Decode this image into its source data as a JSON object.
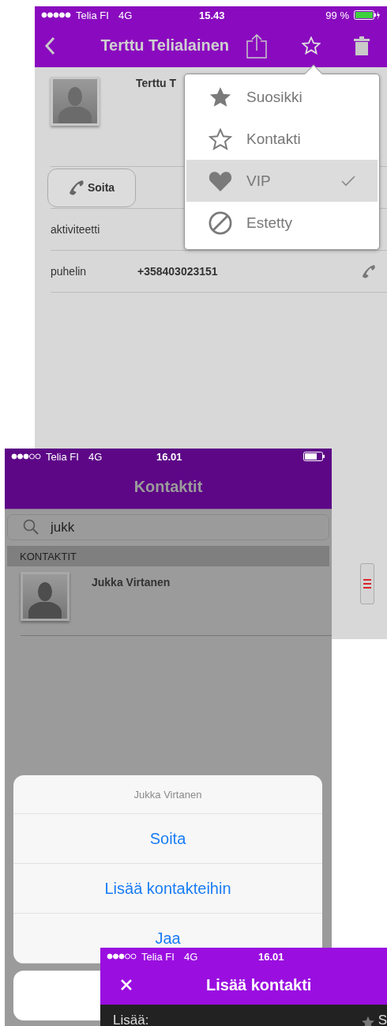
{
  "contact_screen": {
    "status_bar": {
      "carrier": "Telia FI",
      "network": "4G",
      "time": "15.43",
      "battery": "99 %"
    },
    "title": "Terttu Telialainen",
    "name": "Terttu T",
    "call_button": "Soita",
    "fields": [
      {
        "label": "aktiviteetti"
      },
      {
        "label": "puhelin",
        "value": "+358403023151"
      }
    ],
    "menu": [
      {
        "label": "Suosikki",
        "kind": "star",
        "selected": false
      },
      {
        "label": "Kontakti",
        "kind": "star-outline",
        "selected": false
      },
      {
        "label": "VIP",
        "kind": "heart",
        "selected": true
      },
      {
        "label": "Estetty",
        "kind": "blocked",
        "selected": false
      }
    ]
  },
  "contacts_screen": {
    "status_bar": {
      "carrier": "Telia FI",
      "network": "4G",
      "time": "16.01"
    },
    "title": "Kontaktit",
    "search": {
      "value": "jukk"
    },
    "section": "KONTAKTIT",
    "contacts": [
      "Jukka Virtanen"
    ],
    "action_sheet": {
      "title": "Jukka Virtanen",
      "actions": [
        "Soita",
        "Lisää kontakteihin",
        "Jaa"
      ]
    }
  },
  "add_contact_screen": {
    "status_bar": {
      "carrier": "Telia FI",
      "network": "4G",
      "time": "16.01"
    },
    "title": "Lisää kontakti",
    "bar_label": "Lisää:",
    "bar_right": "S"
  }
}
